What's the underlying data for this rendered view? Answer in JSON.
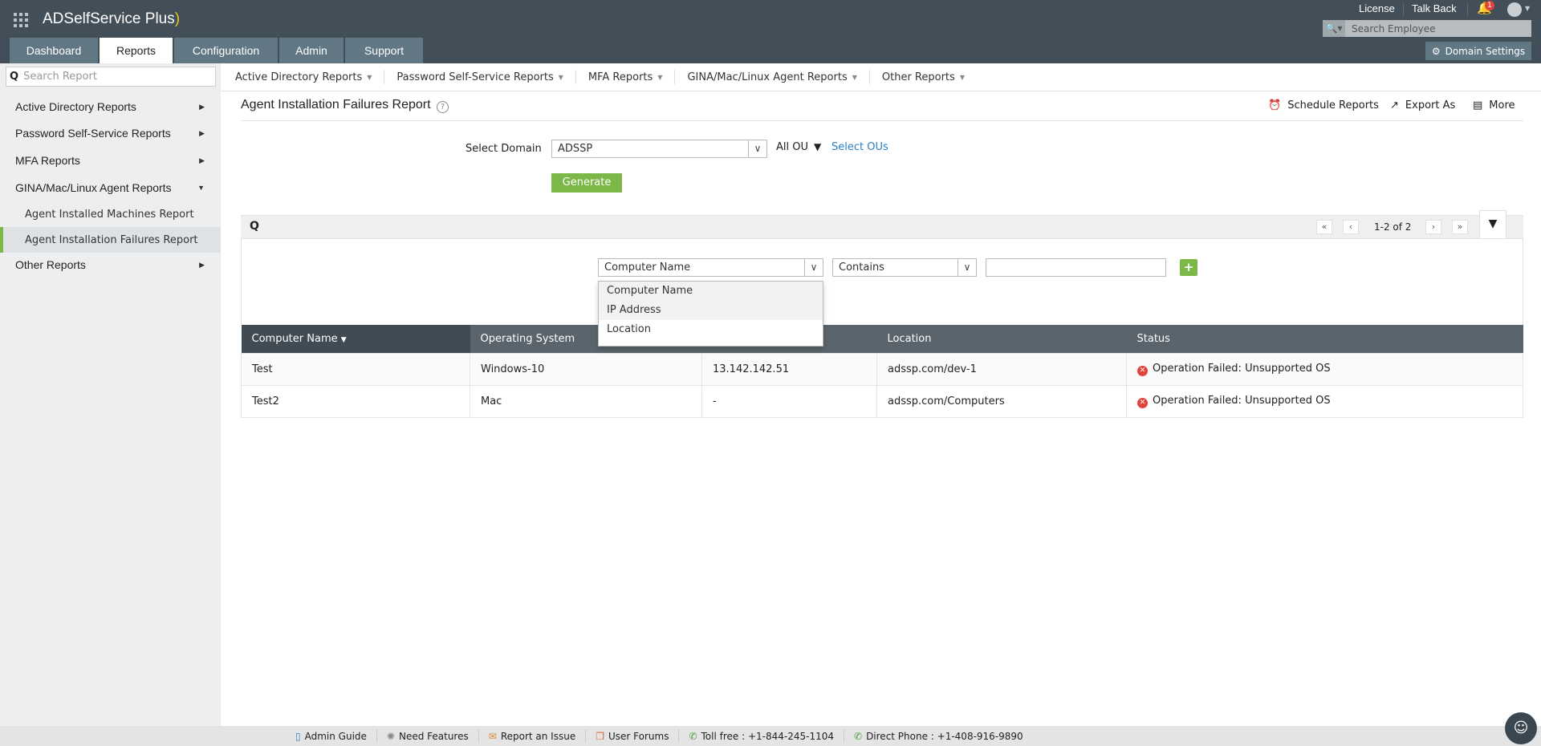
{
  "app": {
    "title": "ADSelfService Plus"
  },
  "tabs": [
    {
      "label": "Dashboard"
    },
    {
      "label": "Reports"
    },
    {
      "label": "Configuration"
    },
    {
      "label": "Admin"
    },
    {
      "label": "Support"
    }
  ],
  "header": {
    "license": "License",
    "talk_back": "Talk Back",
    "notification_count": "1",
    "employee_search_placeholder": "Search Employee",
    "domain_settings": "Domain Settings"
  },
  "sidebar": {
    "search_placeholder": "Search Report",
    "items": [
      {
        "label": "Active Directory Reports"
      },
      {
        "label": "Password Self-Service Reports"
      },
      {
        "label": "MFA Reports"
      },
      {
        "label": "GINA/Mac/Linux Agent Reports"
      },
      {
        "label": "Agent Installed Machines Report"
      },
      {
        "label": "Agent Installation Failures Report"
      },
      {
        "label": "Other Reports"
      }
    ]
  },
  "subnav": [
    {
      "label": "Active Directory Reports"
    },
    {
      "label": "Password Self-Service Reports"
    },
    {
      "label": "MFA Reports"
    },
    {
      "label": "GINA/Mac/Linux Agent Reports"
    },
    {
      "label": "Other Reports"
    }
  ],
  "report": {
    "title": "Agent Installation Failures Report",
    "schedule": "Schedule Reports",
    "export": "Export As",
    "more": "More",
    "domain_label": "Select Domain",
    "domain_value": "ADSSP",
    "all_ou": "All OU",
    "select_ous": "Select OUs",
    "generate": "Generate",
    "pagination": "1-2 of 2"
  },
  "filter": {
    "field": "Computer Name",
    "operator": "Contains",
    "value": "",
    "options": [
      "Computer Name",
      "IP Address",
      "Location"
    ]
  },
  "table": {
    "columns": [
      "Computer Name",
      "Operating System",
      "IP Address",
      "Location",
      "Status"
    ],
    "rows": [
      [
        "Test",
        "Windows-10",
        "13.142.142.51",
        "adssp.com/dev-1",
        "Operation Failed: Unsupported OS"
      ],
      [
        "Test2",
        "Mac",
        "-",
        "adssp.com/Computers",
        "Operation Failed: Unsupported OS"
      ]
    ]
  },
  "footer": [
    {
      "label": "Admin Guide"
    },
    {
      "label": "Need Features"
    },
    {
      "label": "Report an Issue"
    },
    {
      "label": "User Forums"
    },
    {
      "label": "Toll free : +1-844-245-1104"
    },
    {
      "label": "Direct Phone : +1-408-916-9890"
    }
  ],
  "colors": {
    "header": "#434f58",
    "accent": "#7cb848",
    "error": "#e0443a"
  }
}
